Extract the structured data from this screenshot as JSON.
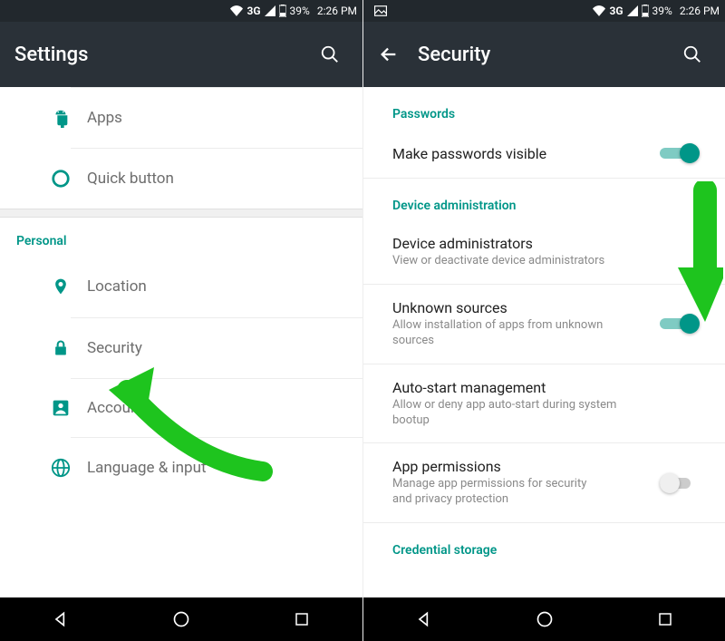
{
  "status": {
    "network": "3G",
    "battery": "39%",
    "time": "2:26 PM"
  },
  "left": {
    "title": "Settings",
    "items": {
      "apps": "Apps",
      "quick": "Quick button"
    },
    "personal_header": "Personal",
    "personal": {
      "location": "Location",
      "security": "Security",
      "accounts": "Accounts",
      "language": "Language & input"
    }
  },
  "right": {
    "title": "Security",
    "sections": {
      "passwords": "Passwords",
      "pw_visible": "Make passwords visible",
      "device_admin_header": "Device administration",
      "dev_admin_title": "Device administrators",
      "dev_admin_sub": "View or deactivate device administrators",
      "unknown_title": "Unknown sources",
      "unknown_sub": "Allow installation of apps from unknown sources",
      "autostart_title": "Auto-start management",
      "autostart_sub": "Allow or deny app auto-start during system bootup",
      "appperm_title": "App permissions",
      "appperm_sub": "Manage app permissions for security and privacy protection",
      "cred_header": "Credential storage"
    }
  }
}
